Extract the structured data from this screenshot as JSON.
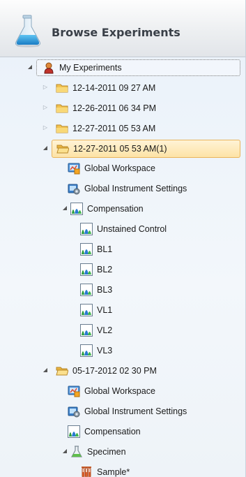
{
  "header": {
    "title": "Browse Experiments"
  },
  "tree": {
    "root": {
      "label": "My Experiments"
    },
    "exp1": {
      "label": "12-14-2011 09 27 AM"
    },
    "exp2": {
      "label": "12-26-2011 06 34 PM"
    },
    "exp3": {
      "label": "12-27-2011 05 53 AM"
    },
    "exp4": {
      "label": "12-27-2011 05 53 AM(1)",
      "global_workspace": "Global Workspace",
      "global_instrument_settings": "Global Instrument Settings",
      "compensation": "Compensation",
      "comp_children": [
        "Unstained Control",
        "BL1",
        "BL2",
        "BL3",
        "VL1",
        "VL2",
        "VL3"
      ]
    },
    "exp5": {
      "label": "05-17-2012 02 30 PM",
      "global_workspace": "Global Workspace",
      "global_instrument_settings": "Global Instrument Settings",
      "compensation": "Compensation",
      "specimen": "Specimen",
      "sample": "Sample*"
    }
  },
  "colors": {
    "selection": "#fde3a6",
    "accent": "#2f8fd6"
  }
}
